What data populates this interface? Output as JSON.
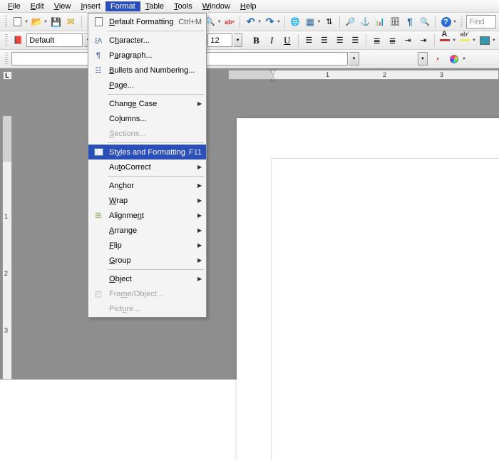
{
  "menubar": {
    "items": [
      {
        "label": "File",
        "ul": "F",
        "rest": "ile"
      },
      {
        "label": "Edit",
        "ul": "E",
        "rest": "dit"
      },
      {
        "label": "View",
        "ul": "V",
        "rest": "iew"
      },
      {
        "label": "Insert",
        "ul": "I",
        "rest": "nsert"
      },
      {
        "label": "Format",
        "ul": "",
        "rest": "Format",
        "open": true
      },
      {
        "label": "Table",
        "ul": "T",
        "rest": "able"
      },
      {
        "label": "Tools",
        "ul": "T",
        "rest": "ools"
      },
      {
        "label": "Window",
        "ul": "W",
        "rest": "indow"
      },
      {
        "label": "Help",
        "ul": "H",
        "rest": "elp"
      }
    ]
  },
  "toolbar1": {
    "style_name": "Default",
    "font_size": "12",
    "find_placeholder": "Find",
    "bold": "B",
    "italic": "I",
    "underline": "U"
  },
  "format_menu": {
    "items": [
      {
        "icon": "doc",
        "label": "Default Formatting",
        "shortcut": "Ctrl+M",
        "ul": "D",
        "rest_before": "",
        "rest_after": "efault Formatting"
      },
      {
        "sep": true
      },
      {
        "icon": "char",
        "label": "Character...",
        "ul": "h",
        "rest_before": "C",
        "rest_after": "aracter..."
      },
      {
        "icon": "para",
        "label": "Paragraph...",
        "ul": "a",
        "rest_before": "P",
        "rest_after": "ragraph..."
      },
      {
        "icon": "bullets",
        "label": "Bullets and Numbering...",
        "ul": "B",
        "rest_before": "",
        "rest_after": "ullets and Numbering..."
      },
      {
        "icon": "",
        "label": "Page...",
        "ul": "P",
        "rest_before": "",
        "rest_after": "age..."
      },
      {
        "sep": true
      },
      {
        "icon": "",
        "label": "Change Case",
        "sub": true,
        "ul": "e",
        "rest_before": "Chang",
        "rest_after": " Case"
      },
      {
        "icon": "",
        "label": "Columns...",
        "ul": "l",
        "rest_before": "Co",
        "rest_after": "umns..."
      },
      {
        "icon": "",
        "label": "Sections...",
        "disabled": true,
        "ul": "S",
        "rest_before": "",
        "rest_after": "ections..."
      },
      {
        "sep": true
      },
      {
        "icon": "styles",
        "label": "Styles and Formatting",
        "shortcut": "F11",
        "highlight": true,
        "ul": "y",
        "rest_before": "St",
        "rest_after": "les and Formatting"
      },
      {
        "icon": "",
        "label": "AutoCorrect",
        "sub": true,
        "ul": "t",
        "rest_before": "Au",
        "rest_after": "oCorrect"
      },
      {
        "sep": true
      },
      {
        "icon": "",
        "label": "Anchor",
        "sub": true,
        "ul": "c",
        "rest_before": "An",
        "rest_after": "hor"
      },
      {
        "icon": "",
        "label": "Wrap",
        "sub": true,
        "ul": "W",
        "rest_before": "",
        "rest_after": "rap"
      },
      {
        "icon": "align",
        "label": "Alignment",
        "sub": true,
        "ul": "n",
        "rest_before": "Alignme",
        "rest_after": "t"
      },
      {
        "icon": "",
        "label": "Arrange",
        "sub": true,
        "ul": "A",
        "rest_before": "",
        "rest_after": "rrange"
      },
      {
        "icon": "",
        "label": "Flip",
        "sub": true,
        "ul": "F",
        "rest_before": "",
        "rest_after": "lip"
      },
      {
        "icon": "",
        "label": "Group",
        "sub": true,
        "ul": "G",
        "rest_before": "",
        "rest_after": "roup"
      },
      {
        "sep": true
      },
      {
        "icon": "",
        "label": "Object",
        "sub": true,
        "ul": "O",
        "rest_before": "",
        "rest_after": "bject"
      },
      {
        "icon": "frame",
        "label": "Frame/Object...",
        "disabled": true,
        "ul": "m",
        "rest_before": "Fra",
        "rest_after": "e/Object..."
      },
      {
        "icon": "",
        "label": "Picture...",
        "disabled": true,
        "ul": "u",
        "rest_before": "Pict",
        "rest_after": "re..."
      }
    ]
  },
  "ruler": {
    "h_marks": [
      "1",
      "2",
      "3"
    ],
    "v_marks": [
      "1",
      "2",
      "3"
    ]
  },
  "tabbox_glyph": "L"
}
